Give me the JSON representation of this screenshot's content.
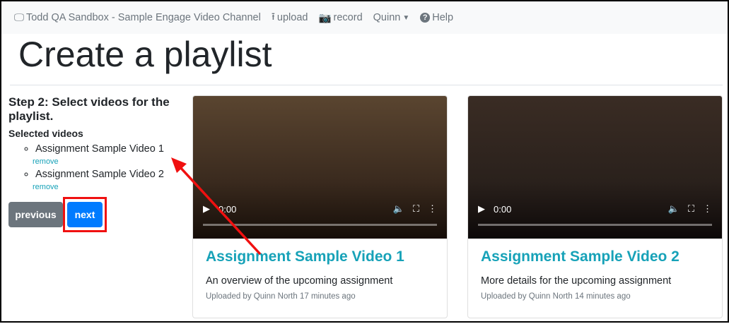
{
  "nav": {
    "brand": "Todd QA Sandbox - Sample Engage Video Channel",
    "upload": "upload",
    "record": "record",
    "user": "Quinn",
    "help": "Help"
  },
  "page_title": "Create a playlist",
  "step": {
    "heading": "Step 2: Select videos for the playlist.",
    "selected_label": "Selected videos",
    "items": [
      {
        "title": "Assignment Sample Video 1",
        "remove": "remove"
      },
      {
        "title": "Assignment Sample Video 2",
        "remove": "remove"
      }
    ],
    "previous": "previous",
    "next": "next"
  },
  "videos": [
    {
      "title": "Assignment Sample Video 1",
      "description": "An overview of the upcoming assignment",
      "meta": "Uploaded by Quinn North 17 minutes ago",
      "time": "0:00"
    },
    {
      "title": "Assignment Sample Video 2",
      "description": "More details for the upcoming assignment",
      "meta": "Uploaded by Quinn North 14 minutes ago",
      "time": "0:00"
    }
  ],
  "colors": {
    "link": "#17a2b8",
    "primary": "#007bff",
    "secondary": "#6c757d",
    "annotation": "#f01010"
  }
}
